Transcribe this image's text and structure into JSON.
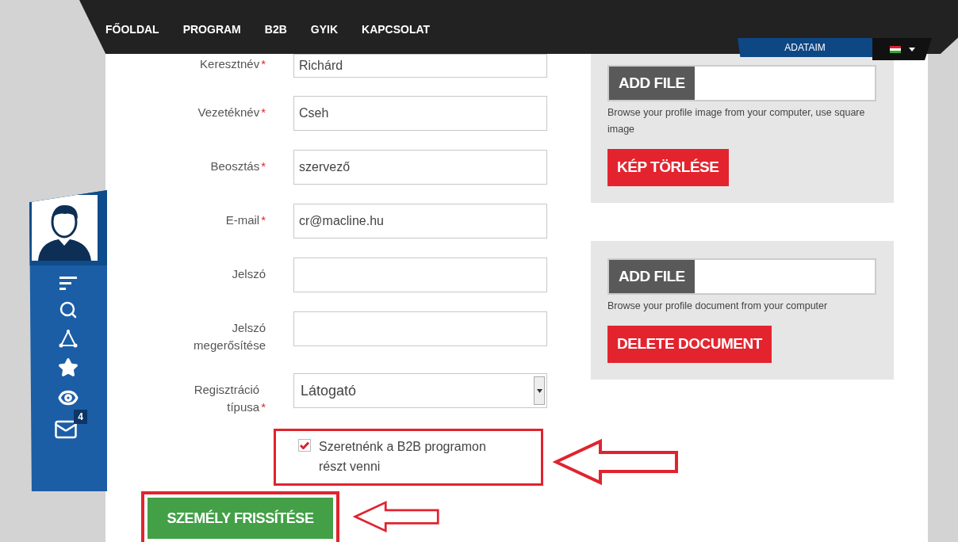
{
  "nav": {
    "items": [
      {
        "label": "FŐOLDAL"
      },
      {
        "label": "PROGRAM"
      },
      {
        "label": "B2B"
      },
      {
        "label": "GYIK"
      },
      {
        "label": "KAPCSOLAT"
      }
    ],
    "user_tab": "ADATAIM"
  },
  "sidebar": {
    "message_count": "4"
  },
  "form": {
    "fields": [
      {
        "kind": "text",
        "label": "Keresztnév",
        "required_mark": "*",
        "value": "Richárd"
      },
      {
        "kind": "text",
        "label": "Vezetéknév",
        "required_mark": "*",
        "value": "Cseh"
      },
      {
        "kind": "text",
        "label": "Beosztás",
        "required_mark": "*",
        "value": "szervező"
      },
      {
        "kind": "text",
        "label": "E-mail",
        "required_mark": "*",
        "value": "cr@macline.hu"
      },
      {
        "kind": "text",
        "label": "Jelszó"
      },
      {
        "kind": "text",
        "label": "Jelszó megerősítése"
      },
      {
        "kind": "select",
        "label": "Regisztráció típusa",
        "required_mark": "*",
        "value": "Látogató"
      }
    ],
    "checkbox": {
      "label": "Szeretnénk a B2B programon részt venni",
      "checked": true
    },
    "submit": "SZEMÉLY FRISSÍTÉSE"
  },
  "uploads": [
    {
      "add_button": "ADD FILE",
      "hint": "Browse your profile image from your computer, use square image",
      "delete_button": "KÉP TÖRLÉSE"
    },
    {
      "add_button": "ADD FILE",
      "hint": "Browse your profile document from your computer",
      "delete_button": "DELETE DOCUMENT"
    }
  ]
}
